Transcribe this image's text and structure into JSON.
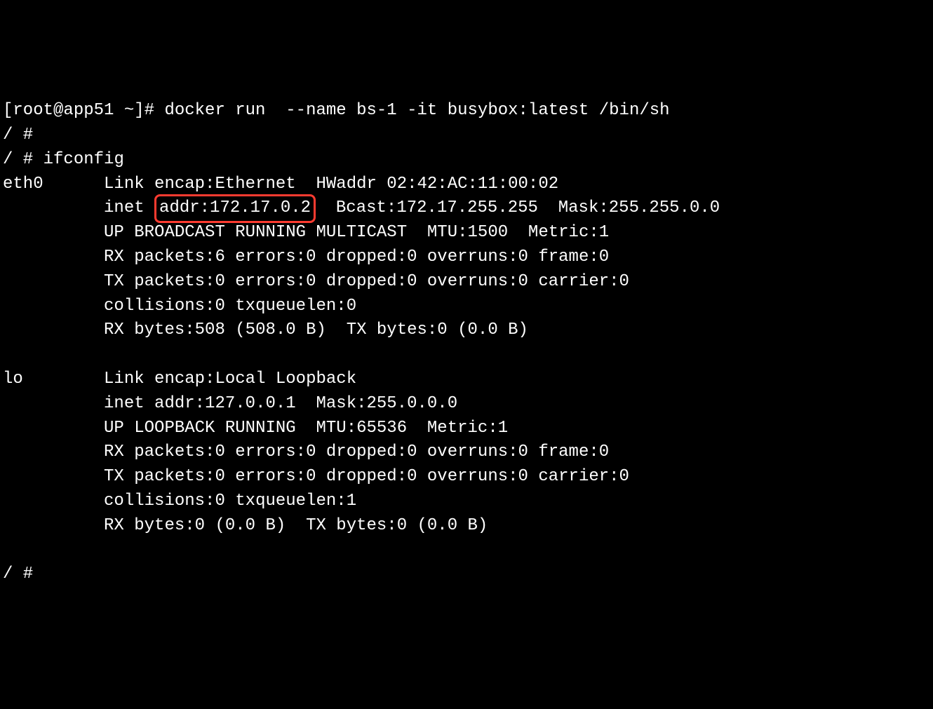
{
  "terminal": {
    "prompt_host": "[root@app51 ~]# ",
    "docker_cmd": "docker run  --name bs-1 -it busybox:latest /bin/sh",
    "shell_prompt": "/ #",
    "ifconfig_cmd": "ifconfig",
    "eth0": {
      "name": "eth0",
      "line1_a": "Link encap:Ethernet  HWaddr 02:42:AC:11:00:02",
      "line2_a": "inet ",
      "line2_highlight": "addr:172.17.0.2",
      "line2_b": "  Bcast:172.17.255.255  Mask:255.255.0.0",
      "line3": "UP BROADCAST RUNNING MULTICAST  MTU:1500  Metric:1",
      "line4": "RX packets:6 errors:0 dropped:0 overruns:0 frame:0",
      "line5": "TX packets:0 errors:0 dropped:0 overruns:0 carrier:0",
      "line6": "collisions:0 txqueuelen:0",
      "line7": "RX bytes:508 (508.0 B)  TX bytes:0 (0.0 B)"
    },
    "lo": {
      "name": "lo",
      "line1": "Link encap:Local Loopback",
      "line2": "inet addr:127.0.0.1  Mask:255.0.0.0",
      "line3": "UP LOOPBACK RUNNING  MTU:65536  Metric:1",
      "line4": "RX packets:0 errors:0 dropped:0 overruns:0 frame:0",
      "line5": "TX packets:0 errors:0 dropped:0 overruns:0 carrier:0",
      "line6": "collisions:0 txqueuelen:1",
      "line7": "RX bytes:0 (0.0 B)  TX bytes:0 (0.0 B)"
    }
  }
}
